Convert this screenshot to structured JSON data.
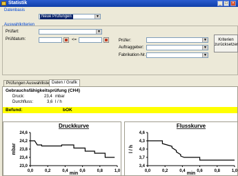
{
  "window": {
    "title": "Statistik",
    "btn_min": "_",
    "btn_max": "□",
    "btn_close": "×"
  },
  "datenbasis": {
    "label": "Datenbasis",
    "value": "Neue Prüfungen"
  },
  "auswahl": {
    "label": "Auswahlkriterien",
    "pruefart_label": "Prüfart:",
    "pruefdatum_label": "Prüfdatum:",
    "range_sep": "<=",
    "pruefer_label": "Prüfer:",
    "auftraggeber_label": "Auftraggeber:",
    "fabrikation_label": "Fabrikation-Nr.:",
    "reset_button": "Kriterien zurücksetzen"
  },
  "tabs": [
    "Prüfungen Auswahlliste",
    "Daten / Grafik"
  ],
  "active_tab": 1,
  "details": {
    "heading": "Gebrauchsfähigkeitsprüfung (CH4)",
    "druck_label": "Druck:",
    "druck_value": "23,4",
    "druck_unit": "mbar",
    "durchfluss_label": "Durchfluss:",
    "durchfluss_value": "3,6",
    "durchfluss_unit": "l / h",
    "befund_label": "Befund:",
    "befund_value": "bOK",
    "befund_color": "#ffff00"
  },
  "chart_data": [
    {
      "type": "line",
      "title": "Druckkurve",
      "xlabel": "min",
      "ylabel": "mbar",
      "xlim": [
        0,
        1.0
      ],
      "ylim": [
        23.0,
        24.6
      ],
      "xticks": [
        "0,0",
        "0,2",
        "0,4",
        "0,6",
        "0,8",
        "1,0"
      ],
      "yticks": [
        "24,6",
        "24,2",
        "23,8",
        "23,4",
        "23,0"
      ],
      "line_color": "#000000",
      "series": [
        {
          "x": [
            0.0,
            0.05,
            0.08,
            0.13,
            0.13,
            0.36,
            0.36,
            0.5,
            0.5,
            0.63,
            0.63,
            0.74,
            0.74,
            0.86,
            0.86,
            0.97
          ],
          "y": [
            24.2,
            24.2,
            24.0,
            24.0,
            23.95,
            23.95,
            24.0,
            24.0,
            23.85,
            23.85,
            23.7,
            23.7,
            23.6,
            23.6,
            23.4,
            23.4
          ]
        }
      ]
    },
    {
      "type": "line",
      "title": "Flusskurve",
      "xlabel": "min",
      "ylabel": "l / h",
      "xlim": [
        0,
        1.0
      ],
      "ylim": [
        3.4,
        4.6
      ],
      "xticks": [
        "0,0",
        "0,2",
        "0,4",
        "0,6",
        "0,8",
        "1,0"
      ],
      "yticks": [
        "4,6",
        "4,3",
        "4,0",
        "3,7",
        "3,4"
      ],
      "line_color": "#000000",
      "series": [
        {
          "x": [
            0.0,
            0.17,
            0.17,
            0.28,
            0.28,
            0.33,
            0.33,
            0.38,
            0.38,
            0.42,
            0.42,
            0.6,
            0.6,
            1.0
          ],
          "y": [
            4.3,
            4.3,
            4.2,
            4.1,
            4.05,
            3.95,
            3.9,
            3.8,
            3.75,
            3.7,
            3.7,
            3.7,
            3.6,
            3.6
          ]
        }
      ]
    }
  ]
}
